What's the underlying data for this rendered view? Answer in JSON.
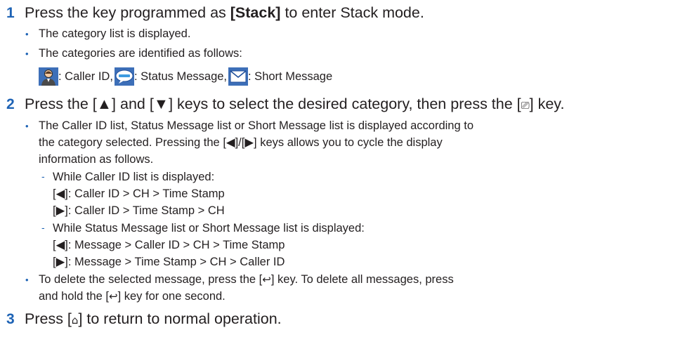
{
  "steps": [
    {
      "number": "1",
      "text_pre": "Press the key programmed as ",
      "text_bold": "[Stack]",
      "text_post": " to enter Stack mode.",
      "bullets": [
        "The category list is displayed.",
        "The categories are identified as follows:"
      ],
      "categories": [
        {
          "icon": "caller-id-icon",
          "label": ": Caller ID, "
        },
        {
          "icon": "status-message-icon",
          "label": ": Status Message, "
        },
        {
          "icon": "short-message-icon",
          "label": ": Short Message"
        }
      ]
    },
    {
      "number": "2",
      "text": "Press the [▲] and [▼] keys to select the desired category, then press the [",
      "key_glyph": "⎚",
      "text_end": "] key.",
      "bullet1_lines": [
        "The Caller ID list, Status Message list or Short Message list is displayed according to",
        "the category selected. Pressing the [◀]/[▶] keys allows you to cycle the display",
        "information as follows."
      ],
      "sub1_title": "While Caller ID list is displayed:",
      "sub1_lines": [
        "[◀]: Caller ID > CH > Time Stamp",
        "[▶]: Caller ID > Time Stamp > CH"
      ],
      "sub2_title": "While Status Message list or Short Message list is displayed:",
      "sub2_lines": [
        "[◀]: Message > Caller ID > CH > Time Stamp",
        "[▶]: Message > Time Stamp > CH > Caller ID"
      ],
      "bullet2_pre": "To delete the selected message, press the [",
      "back_glyph": "↩",
      "bullet2_mid": "] key. To delete all messages, press",
      "bullet2_line2_pre": "and hold the [",
      "bullet2_line2_post": "] key for one second."
    },
    {
      "number": "3",
      "text_pre": "Press [",
      "home_glyph": "⌂",
      "text_post": "] to return to normal operation."
    }
  ],
  "colors": {
    "accent": "#1e63b5",
    "text": "#231f20"
  }
}
